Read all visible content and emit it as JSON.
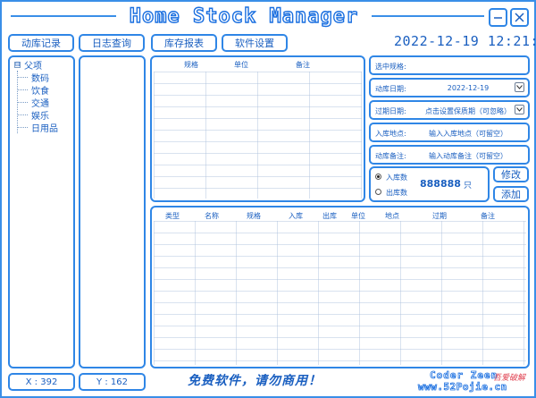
{
  "window": {
    "title": "Home Stock Manager",
    "minimize_icon": "minimize-icon",
    "close_icon": "close-icon"
  },
  "toolbar": {
    "tabs": [
      "动库记录",
      "日志查询",
      "库存报表",
      "软件设置"
    ]
  },
  "clock": "2022-12-19  12:21:",
  "tree": {
    "root": "父项",
    "toggle": "⊟",
    "children": [
      "数码",
      "饮食",
      "交通",
      "娱乐",
      "日用品"
    ]
  },
  "top_table": {
    "columns": [
      "规格",
      "单位",
      "备注"
    ]
  },
  "form": {
    "spec_label": "选中规格:",
    "date_label": "动库日期:",
    "date_value": "2022-12-19",
    "expire_label": "过期日期:",
    "expire_value": "点击设置保质期（可忽略）",
    "location_label": "入库地点:",
    "location_value": "输入入库地点（可留空）",
    "note_label": "动库备注:",
    "note_value": "输入动库备注（可留空）",
    "calendar_icon": "calendar-icon"
  },
  "quantity": {
    "in_label": "入库数",
    "out_label": "出库数",
    "value": "888888",
    "unit": "只",
    "selected": "in"
  },
  "actions": {
    "modify": "修改",
    "add": "添加"
  },
  "bottom_table": {
    "columns": [
      "类型",
      "名称",
      "规格",
      "入库",
      "出库",
      "单位",
      "地点",
      "过期",
      "备注"
    ]
  },
  "status": {
    "x": "X : 392",
    "y": "Y : 162"
  },
  "footer": {
    "notice": "免费软件，请勿商用！",
    "coder": "Coder Zeen",
    "site": "www.52Pojie.cn",
    "watermark": "吾爱破解"
  }
}
